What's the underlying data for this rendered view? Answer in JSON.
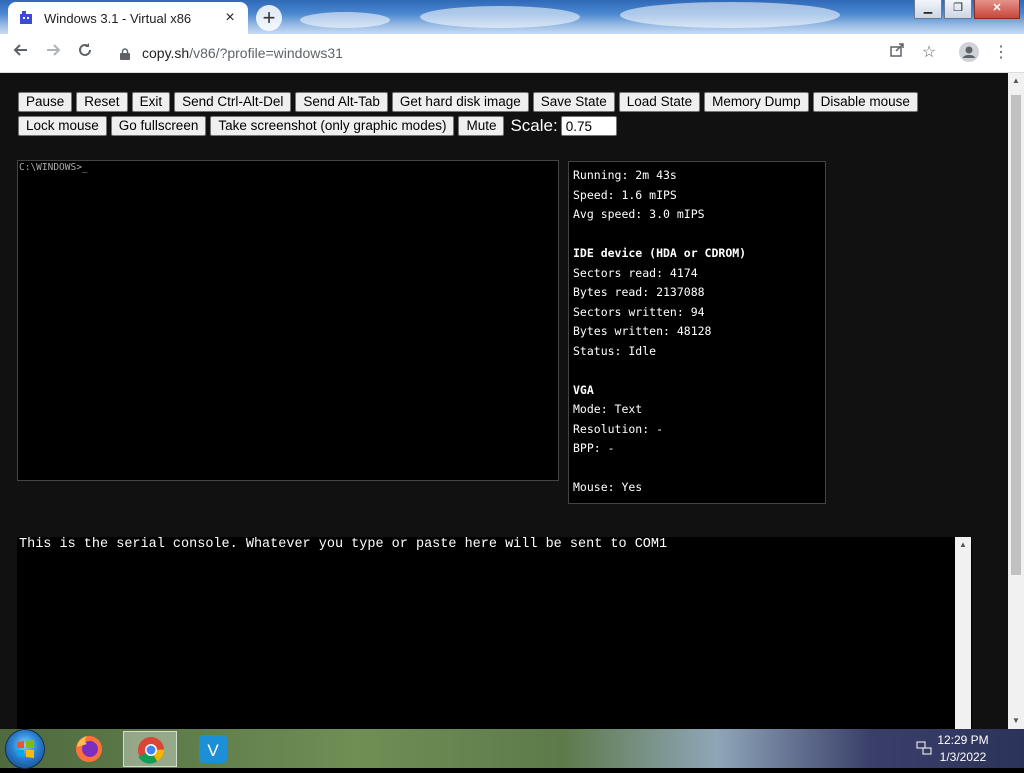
{
  "browser": {
    "tab_title": "Windows 3.1 - Virtual x86",
    "tab_close": "×",
    "new_tab": "+",
    "url_host": "copy.sh",
    "url_path": "/v86/?profile=windows31",
    "window_controls": {
      "minimize": "▁",
      "maximize": "❐",
      "close": "✕"
    }
  },
  "controls": {
    "row1": [
      "Pause",
      "Reset",
      "Exit",
      "Send Ctrl-Alt-Del",
      "Send Alt-Tab",
      "Get hard disk image",
      "Save State",
      "Load State",
      "Memory Dump",
      "Disable mouse"
    ],
    "row2": [
      "Lock mouse",
      "Go fullscreen",
      "Take screenshot (only graphic modes)",
      "Mute"
    ],
    "scale_label": "Scale:",
    "scale_value": "0.75"
  },
  "screen": {
    "prompt": "C:\\WINDOWS>_"
  },
  "stats": {
    "running": "Running: 2m 43s",
    "speed": "Speed: 1.6 mIPS",
    "avg_speed": "Avg speed: 3.0 mIPS",
    "ide_header": "IDE device (HDA or CDROM)",
    "sectors_read": "Sectors read: 4174",
    "bytes_read": "Bytes read: 2137088",
    "sectors_written": "Sectors written: 94",
    "bytes_written": "Bytes written: 48128",
    "status": "Status: Idle",
    "vga_header": "VGA",
    "mode": "Mode: Text",
    "resolution": "Resolution: -",
    "bpp": "BPP: -",
    "mouse": "Mouse: Yes"
  },
  "serial": {
    "text": "This is the serial console. Whatever you type or paste here will be sent to COM1"
  },
  "taskbar": {
    "time": "12:29 PM",
    "date": "1/3/2022",
    "apps": [
      "firefox-icon",
      "chrome-icon",
      "vmware-icon"
    ]
  },
  "colors": {
    "page_bg": "#111111",
    "console_bg": "#000000",
    "text": "#ffffff"
  }
}
